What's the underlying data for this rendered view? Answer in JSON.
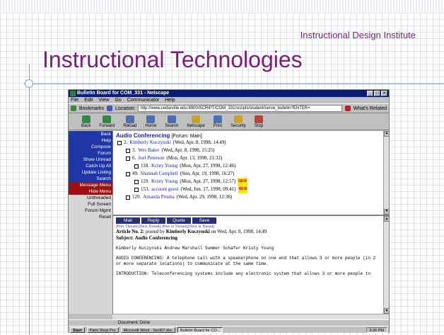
{
  "slide": {
    "subtitle": "Instructional Design Institute",
    "title": "Instructional Technologies"
  },
  "window": {
    "title": "Bulletin Board for COM_331 - Netscape",
    "menu": [
      "File",
      "Edit",
      "View",
      "Go",
      "Communicator",
      "Help"
    ],
    "bookmarks_label": "Bookmarks",
    "location_label": "Location:",
    "url": "http://www.cedarville.edu:8900/SCRIPT/COM_331/scripts/student/serve_bulletin?ENTER+",
    "whats_related": "What's Related",
    "toolbar": [
      "Back",
      "Forward",
      "Reload",
      "Home",
      "Search",
      "Netscape",
      "Print",
      "Security",
      "Stop"
    ]
  },
  "nav": [
    {
      "label": "Back",
      "style": "blue"
    },
    {
      "label": "Help",
      "style": "blue"
    },
    {
      "label": "Compose",
      "style": "blue"
    },
    {
      "label": "Forum",
      "style": "blue"
    },
    {
      "label": "Show Unread",
      "style": "blue"
    },
    {
      "label": "Catch Up All",
      "style": "blue"
    },
    {
      "label": "Update Listing",
      "style": "blue"
    },
    {
      "label": "Search",
      "style": "blue"
    },
    {
      "label": "Message Menu",
      "style": "red"
    },
    {
      "label": "Hide Menu",
      "style": "red"
    },
    {
      "label": "Unthreaded",
      "style": "gray"
    },
    {
      "label": "Full Screen",
      "style": "gray"
    },
    {
      "label": "Forum Mgmt",
      "style": "gray"
    },
    {
      "label": "Reset",
      "style": "gray"
    }
  ],
  "thread_panel": {
    "title": "Audio Conferencing",
    "forum": "[Forum: Main]",
    "threads": [
      {
        "indent": 0,
        "num": "2.",
        "author": "Kimberly Kuczynski",
        "date": "(Wed, Apr. 8, 1998, 14:49)",
        "new": false
      },
      {
        "indent": 1,
        "num": "3.",
        "author": "Wes Baker",
        "date": "(Wed, Apr. 8, 1998, 15:25)",
        "new": false
      },
      {
        "indent": 1,
        "num": "6.",
        "author": "Joel Peterson",
        "date": "(Mon, Apr. 13, 1998, 21:32)",
        "new": false
      },
      {
        "indent": 2,
        "num": "118.",
        "author": "Kristy Young",
        "date": "(Mon, Apr. 27, 1998, 12:46)",
        "new": false
      },
      {
        "indent": 1,
        "num": "49.",
        "author": "Shannah Campbell",
        "date": "(Sun, Apr. 19, 1998, 16:27)",
        "new": false
      },
      {
        "indent": 2,
        "num": "119.",
        "author": "Kristy Young",
        "date": "(Mon, Apr. 27, 1998, 12:57)",
        "new": true
      },
      {
        "indent": 2,
        "num": "153.",
        "author": "account guest",
        "date": "(Wed, Jun. 17, 1998, 09:41)",
        "new": true
      },
      {
        "indent": 1,
        "num": "129.",
        "author": "Amanda Prusha",
        "date": "(Wed, Apr. 29, 1998, 12:38)",
        "new": false
      }
    ],
    "new_badge": "NEW"
  },
  "message_panel": {
    "actions": [
      "Mail",
      "Reply",
      "Quote",
      "Save"
    ],
    "links": "[Prev Thread] [Next Thread] [Prev in Thread] [Next in Thread]",
    "article_prefix": "Article No. 2:",
    "posted_by": "posted by",
    "author": "Kimberly Kuczynski",
    "posted_date": "on Wed, Apr. 8, 1998, 14:49",
    "subject_prefix": "Subject:",
    "subject": "Audio Conferencing",
    "body_names": "Kimberly Kuczynski Andrew Marshall Summer Schafer Kristy Young",
    "body_p1": "AUDIO CONFERENCING: A telephone call with a speakerphone on one end that allows 3 or more people (in 2 or more separate locations) to communicate at the same time.",
    "body_p2": "INTRODUCTION: Teleconferencing systems include any electronic system that allows 3 or more people to"
  },
  "status": "Document: Done",
  "taskbar": {
    "start": "Start",
    "tasks": [
      "Paint Shop Pro",
      "Microsoft Word - Sect07.doc",
      "Bulletin Board for CO..."
    ],
    "clock": "3:26 PM"
  }
}
